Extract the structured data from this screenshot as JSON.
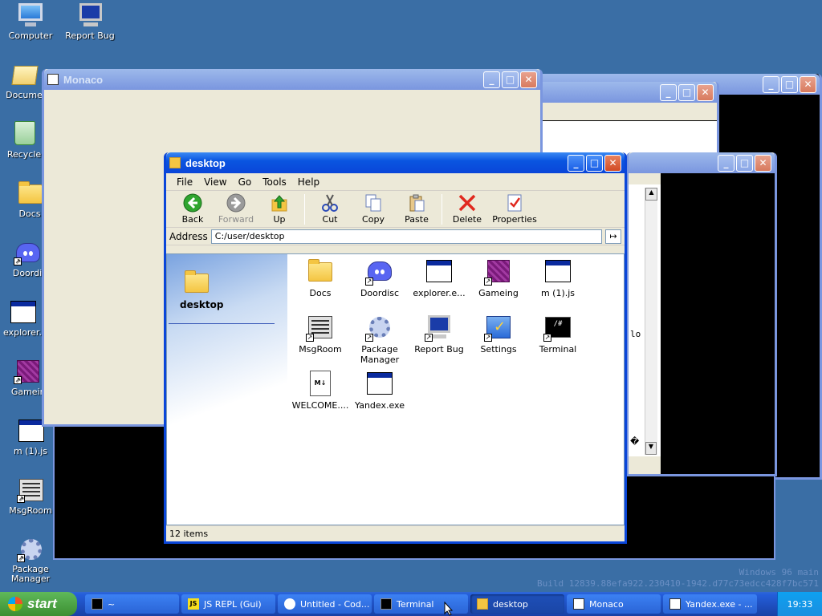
{
  "desktop_icons": [
    {
      "label": "Computer",
      "icon": "computer-icon"
    },
    {
      "label": "Report Bug",
      "icon": "report-bug-icon"
    },
    {
      "label": "Docume",
      "icon": "documents-icon"
    },
    {
      "label": "Recycle",
      "icon": "recycle-bin-icon"
    },
    {
      "label": "Docs",
      "icon": "folder-icon"
    },
    {
      "label": "Doordi",
      "icon": "discord-icon"
    },
    {
      "label": "explorer.",
      "icon": "explorer-icon"
    },
    {
      "label": "Gameir",
      "icon": "gaming-icon"
    },
    {
      "label": "m (1).js",
      "icon": "window-icon"
    },
    {
      "label": "MsgRoom",
      "icon": "msgroom-icon"
    },
    {
      "label": "Package Manager",
      "icon": "package-manager-icon"
    }
  ],
  "windows": {
    "monaco": {
      "title": "Monaco"
    },
    "explorer": {
      "title": "desktop",
      "menu": [
        "File",
        "View",
        "Go",
        "Tools",
        "Help"
      ],
      "toolbar": {
        "back": "Back",
        "forward": "Forward",
        "up": "Up",
        "cut": "Cut",
        "copy": "Copy",
        "paste": "Paste",
        "delete": "Delete",
        "properties": "Properties"
      },
      "address_label": "Address",
      "address_value": "C:/user/desktop",
      "go_glyph": "↦",
      "pane_title": "desktop",
      "files": [
        {
          "label": "Docs",
          "icon": "folder-icon"
        },
        {
          "label": "Doordisc",
          "icon": "discord-icon"
        },
        {
          "label": "explorer.e...",
          "icon": "explorer-icon"
        },
        {
          "label": "Gameing",
          "icon": "gaming-icon"
        },
        {
          "label": "m (1).js",
          "icon": "window-icon"
        },
        {
          "label": "MsgRoom",
          "icon": "msgroom-icon"
        },
        {
          "label": "Package Manager",
          "icon": "package-manager-icon"
        },
        {
          "label": "Report Bug",
          "icon": "report-bug-icon"
        },
        {
          "label": "Settings",
          "icon": "settings-icon"
        },
        {
          "label": "Terminal",
          "icon": "terminal-icon"
        },
        {
          "label": "WELCOME....",
          "icon": "markdown-icon"
        },
        {
          "label": "Yandex.exe",
          "icon": "window-icon"
        }
      ],
      "status": "12 items"
    },
    "bg_text": {
      "fragment": "lo",
      "glyph": "�"
    }
  },
  "taskbar": {
    "start": "start",
    "tasks": [
      {
        "label": "~",
        "icon": "terminal-icon",
        "active": false
      },
      {
        "label": "JS REPL (Gui)",
        "icon": "js-icon",
        "active": false
      },
      {
        "label": "Untitled - Cod...",
        "icon": "code-icon",
        "active": false
      },
      {
        "label": "Terminal",
        "icon": "terminal-icon",
        "active": false
      },
      {
        "label": "desktop",
        "icon": "folder-icon",
        "active": true
      },
      {
        "label": "Monaco",
        "icon": "window-icon",
        "active": false
      },
      {
        "label": "Yandex.exe - ...",
        "icon": "window-icon",
        "active": false
      }
    ],
    "clock": "19:33"
  },
  "watermark": {
    "line1": "Windows 96 main",
    "line2": "Build 12839.88efa922.230410-1942.d77c73edcc428f7bc571"
  },
  "colors": {
    "desktop": "#3a6ea5",
    "titlebar": "#0a46d9",
    "taskbar": "#245edb",
    "start": "#3c8f31"
  }
}
